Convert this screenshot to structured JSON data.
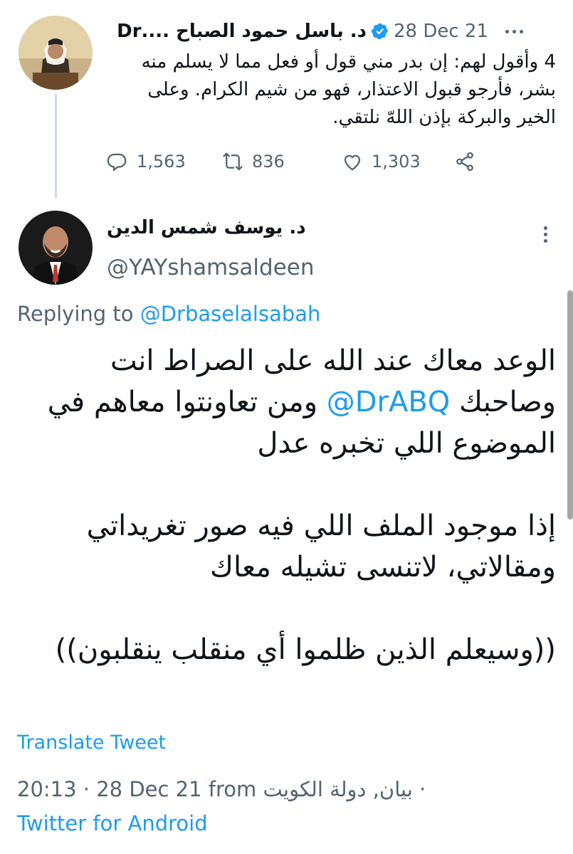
{
  "parent_tweet": {
    "author_name": "د. باسل حمود الصباح ....Dr",
    "date": "28 Dec 21",
    "text": "4 وأقول لهم: إن بدر مني قول أو فعل مما لا يسلم منه بشر، فأرجو قبول الاعتذار، فهو من شيم الكرام. وعلى الخير والبركة بإذن اللهّ نلتقي.",
    "replies": "1,563",
    "retweets": "836",
    "likes": "1,303"
  },
  "reply_tweet": {
    "author_name": "د. يوسف شمس الدين",
    "handle": "@YAYshamsaldeen",
    "replying_prefix": "Replying to",
    "replying_to": "@Drbaselalsabah",
    "text_part1": "الوعد معاك عند الله على الصراط انت وصاحبك",
    "mention": "@DrABQ",
    "text_part2": "ومن تعاونتوا معاهم في الموضوع اللي تخبره عدل\n\nإذا موجود الملف اللي فيه صور تغريداتي ومقالاتي، لاتنسى تشيله معاك\n\n((وسيعلم الذين ظلموا أي منقلب ينقلبون))",
    "translate_label": "Translate Tweet",
    "time_date": "20:13 · 28 Dec 21 from",
    "location": "بيان, دولة الكويت",
    "location_sep": "·",
    "client": "Twitter for Android"
  },
  "colors": {
    "accent": "#1d9bf0",
    "secondary_text": "#536471",
    "thread_line": "#cfd9de"
  },
  "icons": [
    "reply-icon",
    "retweet-icon",
    "like-icon",
    "share-icon",
    "verified-icon",
    "more-icon"
  ]
}
